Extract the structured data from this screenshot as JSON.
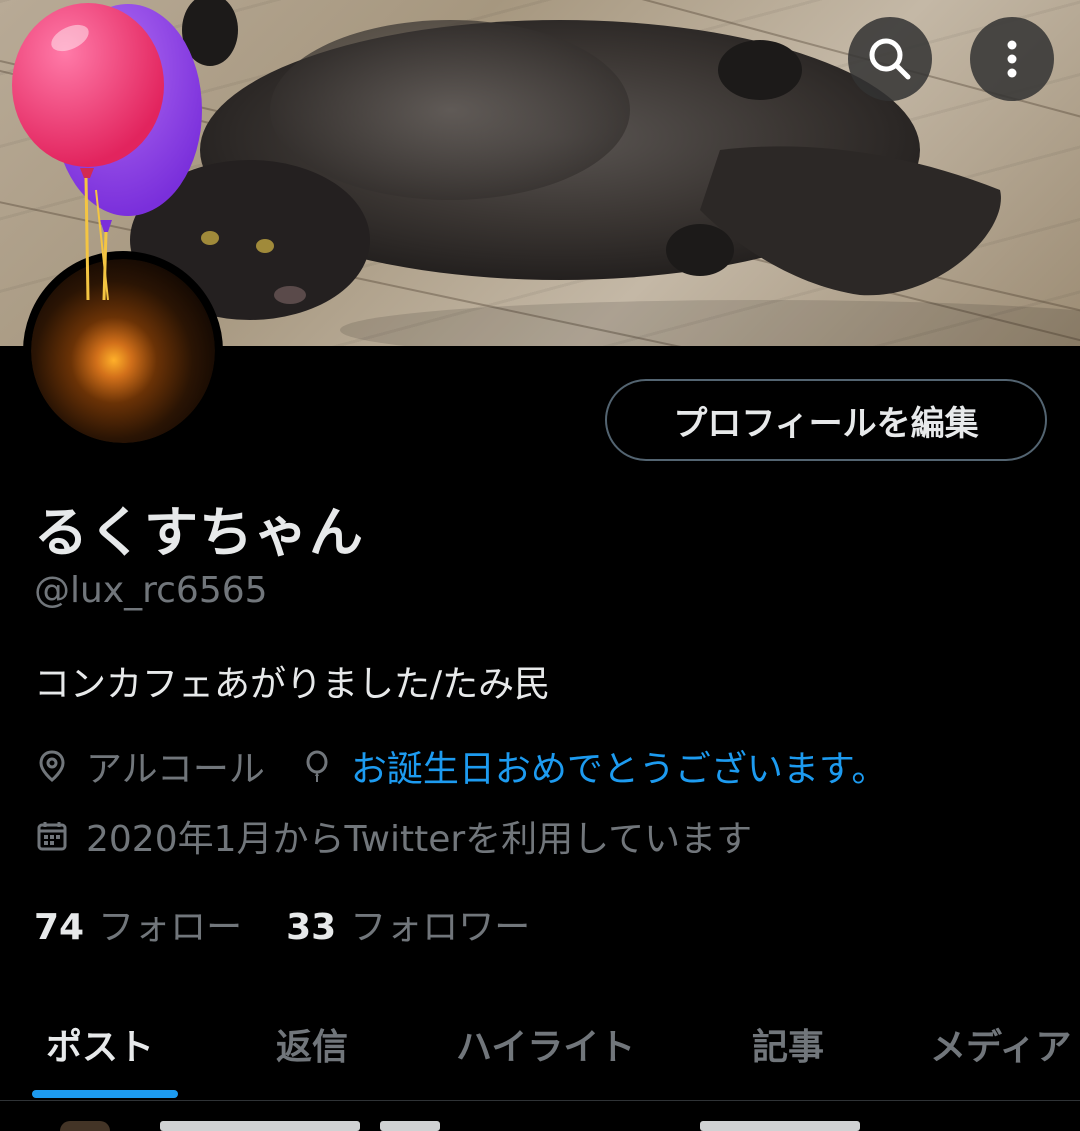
{
  "header": {
    "search_icon": "search-icon",
    "more_icon": "more-vertical-icon"
  },
  "profile": {
    "edit_button_label": "プロフィールを編集",
    "display_name": "るくすちゃん",
    "handle": "@lux_rc6565",
    "bio": "コンカフェあがりました/たみ民",
    "location": "アルコール",
    "birthday_text": "お誕生日おめでとうございます。",
    "joined": "2020年1月からTwitterを利用しています",
    "following_count": "74",
    "following_label": "フォロー",
    "followers_count": "33",
    "followers_label": "フォロワー"
  },
  "tabs": [
    {
      "label": "ポスト",
      "active": true
    },
    {
      "label": "返信"
    },
    {
      "label": "ハイライト"
    },
    {
      "label": "記事"
    },
    {
      "label": "メディア"
    }
  ],
  "colors": {
    "accent": "#1d9bf0",
    "background": "#000000",
    "text_primary": "#e7e9ea",
    "text_secondary": "#71767b"
  }
}
